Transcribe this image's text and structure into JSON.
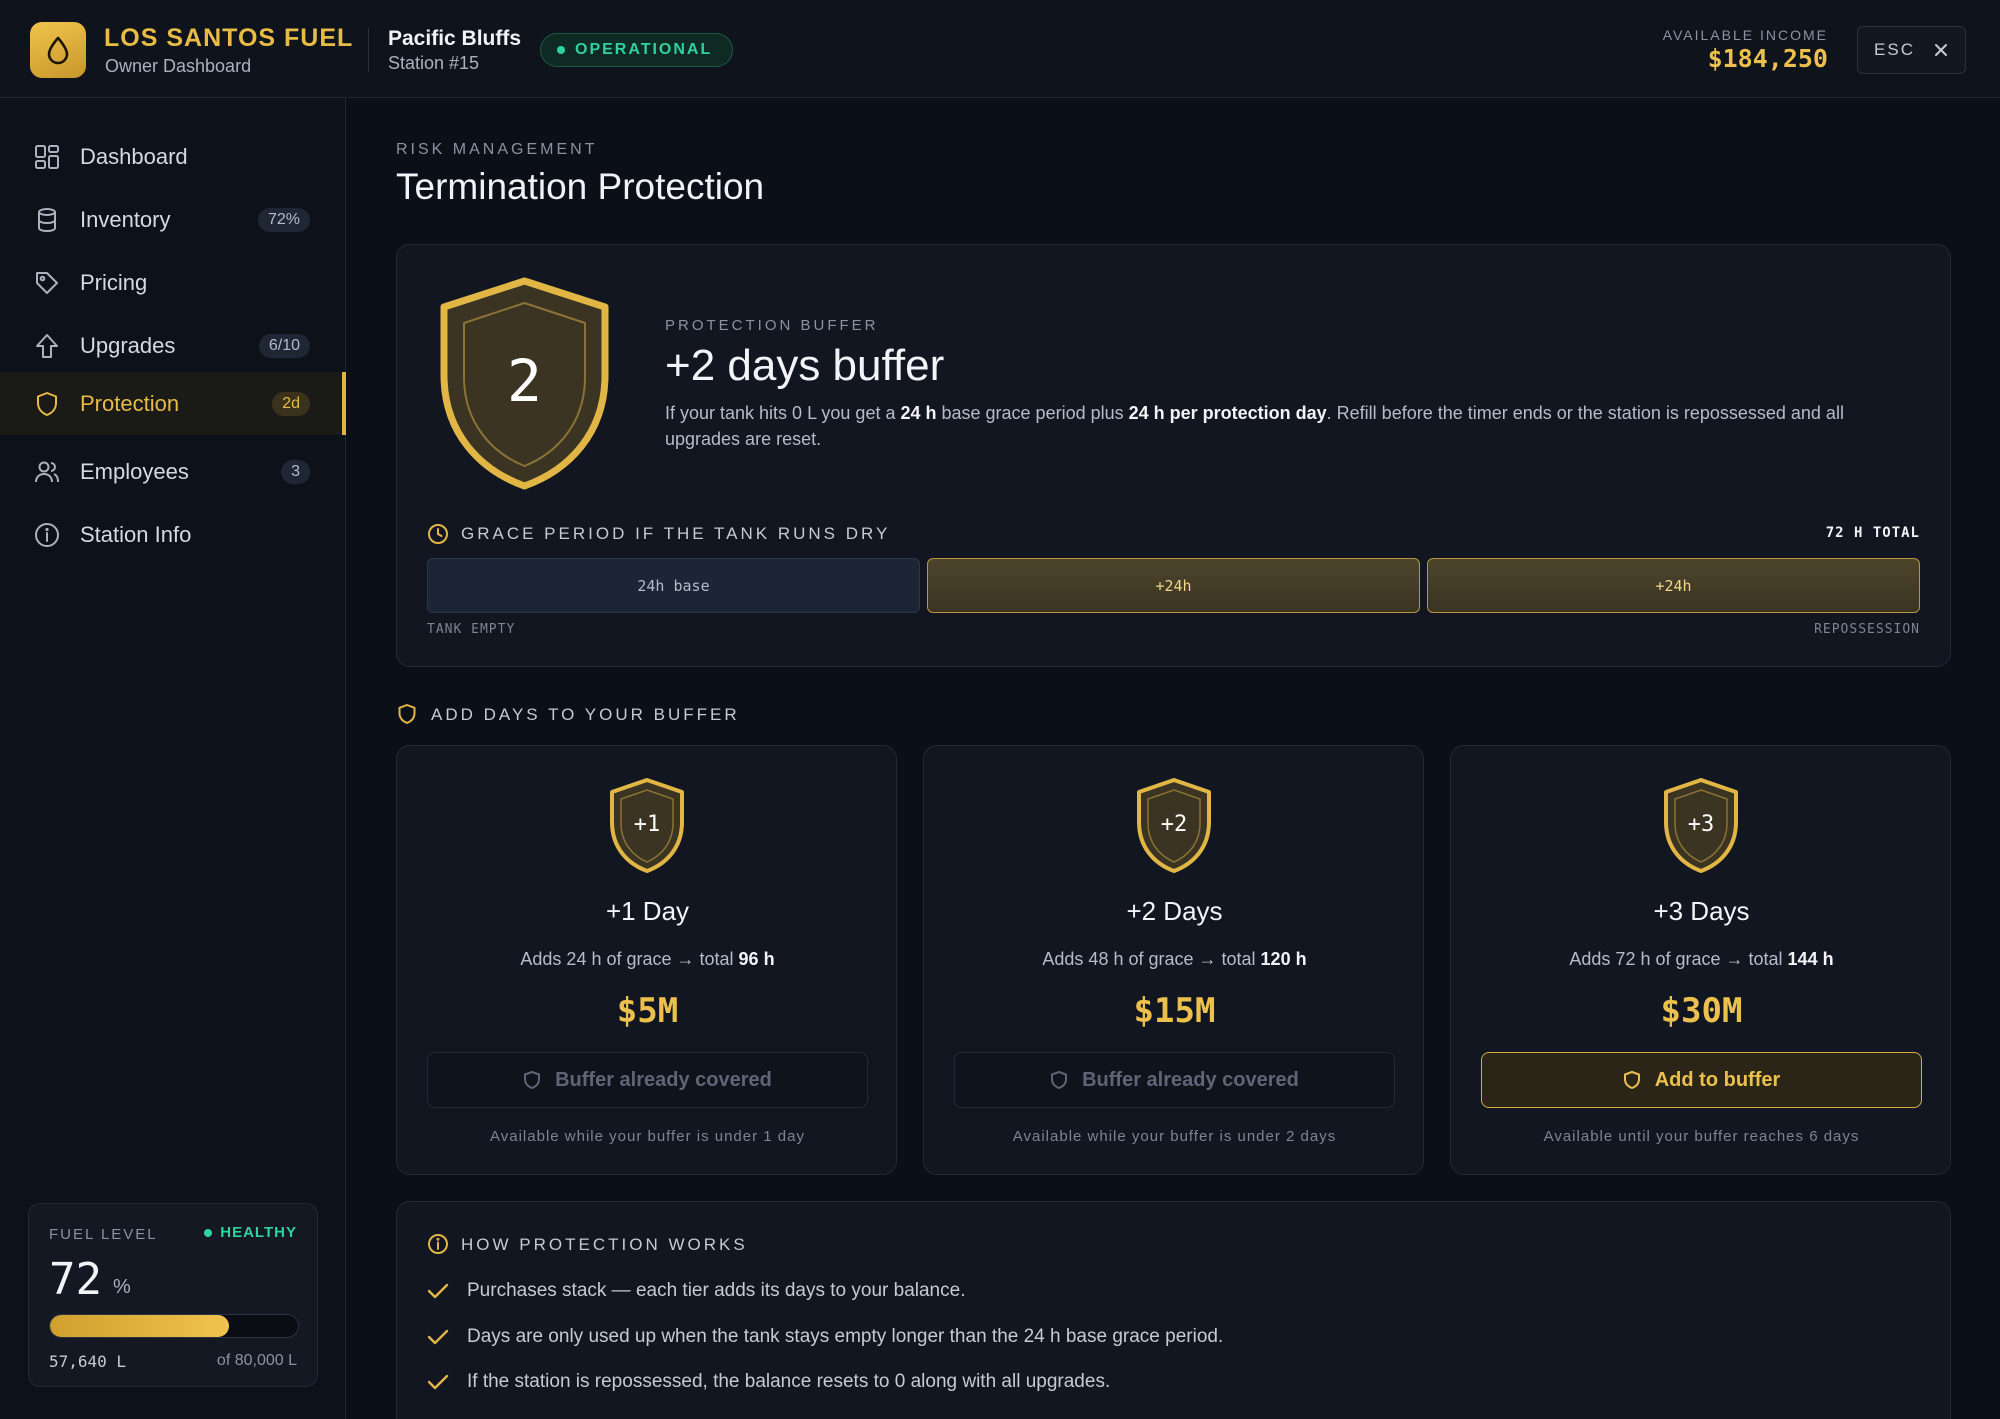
{
  "header": {
    "brand_title": "LOS SANTOS FUEL",
    "brand_subtitle": "Owner Dashboard",
    "station_name": "Pacific Bluffs",
    "station_number": "Station #15",
    "status": "OPERATIONAL",
    "income_label": "AVAILABLE INCOME",
    "income_value": "$184,250",
    "close_label": "ESC"
  },
  "sidebar": {
    "items": [
      {
        "label": "Dashboard",
        "badge": "",
        "icon": "grid-icon"
      },
      {
        "label": "Inventory",
        "badge": "72%",
        "icon": "database-icon"
      },
      {
        "label": "Pricing",
        "badge": "",
        "icon": "tag-icon"
      },
      {
        "label": "Upgrades",
        "badge": "6/10",
        "icon": "arrow-up-icon"
      },
      {
        "label": "Protection",
        "badge": "2d",
        "icon": "shield-icon",
        "active": true
      },
      {
        "label": "Employees",
        "badge": "3",
        "icon": "users-icon"
      },
      {
        "label": "Station Info",
        "badge": "",
        "icon": "info-icon"
      }
    ],
    "fuel": {
      "label": "FUEL LEVEL",
      "status": "HEALTHY",
      "percent": "72",
      "unit": "%",
      "fill_fraction": 0.72,
      "quantity": "57,640 L",
      "capacity": "of 80,000 L"
    }
  },
  "page": {
    "eyebrow": "RISK MANAGEMENT",
    "title": "Termination Protection"
  },
  "hero": {
    "shield_number": "2",
    "eyebrow": "PROTECTION BUFFER",
    "title": "+2 days buffer",
    "desc_1": "If your tank hits 0 L you get a ",
    "desc_b1": "24 h",
    "desc_2": " base grace period plus ",
    "desc_b2": "24 h per protection day",
    "desc_3": ". Refill before the timer ends or the station is repossessed and all upgrades are reset.",
    "grace_label": "GRACE PERIOD IF THE TANK RUNS DRY",
    "grace_total": "72 H TOTAL",
    "segments": [
      "24h base",
      "+24h",
      "+24h"
    ],
    "caption_start": "TANK EMPTY",
    "caption_end": "REPOSSESSION"
  },
  "tiers": {
    "section_label": "ADD DAYS TO YOUR BUFFER",
    "items": [
      {
        "badge": "+1",
        "name": "+1 Day",
        "desc": "Adds 24 h of grace → total ",
        "total": "96 h",
        "price": "$5M",
        "button": "Buffer already covered",
        "note": "Available while your buffer is under 1 day"
      },
      {
        "badge": "+2",
        "name": "+2 Days",
        "desc": "Adds 48 h of grace → total ",
        "total": "120 h",
        "price": "$15M",
        "button": "Buffer already covered",
        "note": "Available while your buffer is under 2 days"
      },
      {
        "badge": "+3",
        "name": "+3 Days",
        "desc": "Adds 72 h of grace → total ",
        "total": "144 h",
        "price": "$30M",
        "button": "Add to buffer",
        "note": "Available until your buffer reaches 6 days"
      }
    ]
  },
  "how": {
    "label": "HOW PROTECTION WORKS",
    "rows": [
      "Purchases stack — each tier adds its days to your balance.",
      "Days are only used up when the tank stays empty longer than the 24 h base grace period.",
      "If the station is repossessed, the balance resets to 0 along with all upgrades."
    ]
  },
  "colors": {
    "accent": "#e7bb45",
    "success": "#2fd39b",
    "background": "#0b0f17"
  }
}
